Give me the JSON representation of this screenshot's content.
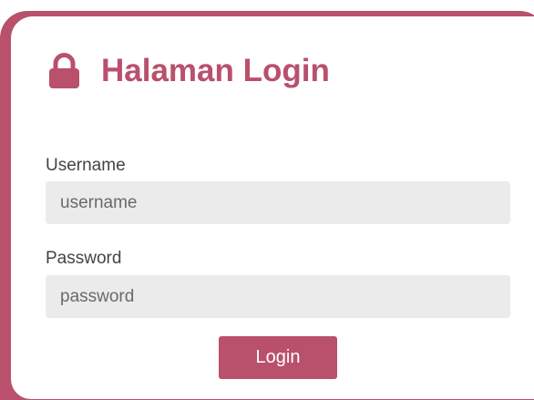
{
  "login": {
    "title": "Halaman Login",
    "title_icon": "lock-icon",
    "username_label": "Username",
    "username_placeholder": "username",
    "password_label": "Password",
    "password_placeholder": "password",
    "login_button": "Login"
  },
  "colors": {
    "accent": "#b9506c",
    "field_bg": "#ebebeb",
    "text": "#444444"
  }
}
